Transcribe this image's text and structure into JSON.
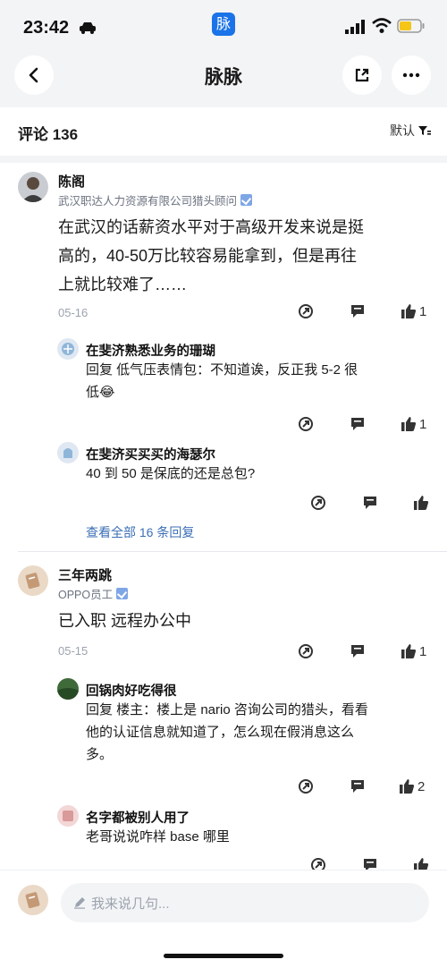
{
  "status_bar": {
    "time": "23:42",
    "app_badge": "脉"
  },
  "nav": {
    "title": "脉脉"
  },
  "comments_header": {
    "title": "评论 136",
    "sort_label": "默认"
  },
  "comments": [
    {
      "name": "陈阁",
      "subtitle": "武汉职达人力资源有限公司猎头顾问",
      "body_lines": [
        "在武汉的话薪资水平对于高级开发来说是挺",
        "高的，40-50万比较容易能拿到，但是再往",
        "上就比较难了……"
      ],
      "date": "05-16",
      "like_count": "1",
      "replies": [
        {
          "name": "在斐济熟悉业务的珊瑚",
          "lines": [
            "回复 低气压表情包：不知道诶，反正我 5-2 很",
            "低😂"
          ],
          "like_count": "1"
        },
        {
          "name": "在斐济买买买的海瑟尔",
          "lines": [
            "40 到 50 是保底的还是总包?"
          ],
          "like_count": ""
        }
      ],
      "view_all": "查看全部 16 条回复"
    },
    {
      "name": "三年两跳",
      "subtitle": "OPPO员工",
      "body_lines": [
        "已入职 远程办公中"
      ],
      "date": "05-15",
      "like_count": "1",
      "replies": [
        {
          "name": "回锅肉好吃得很",
          "lines": [
            "回复  楼主：楼上是 nario 咨询公司的猎头，看看",
            "他的认证信息就知道了，怎么现在假消息这么",
            "多。"
          ],
          "like_count": "2"
        },
        {
          "name": "名字都被别人用了",
          "lines": [
            "老哥说说咋样 base 哪里"
          ],
          "like_count": ""
        }
      ]
    }
  ],
  "bottom_bar": {
    "placeholder": "我来说几句..."
  },
  "colors": {
    "accent": "#1a73e8",
    "link": "#3b6fb6",
    "background_gray": "#f3f4f6"
  }
}
